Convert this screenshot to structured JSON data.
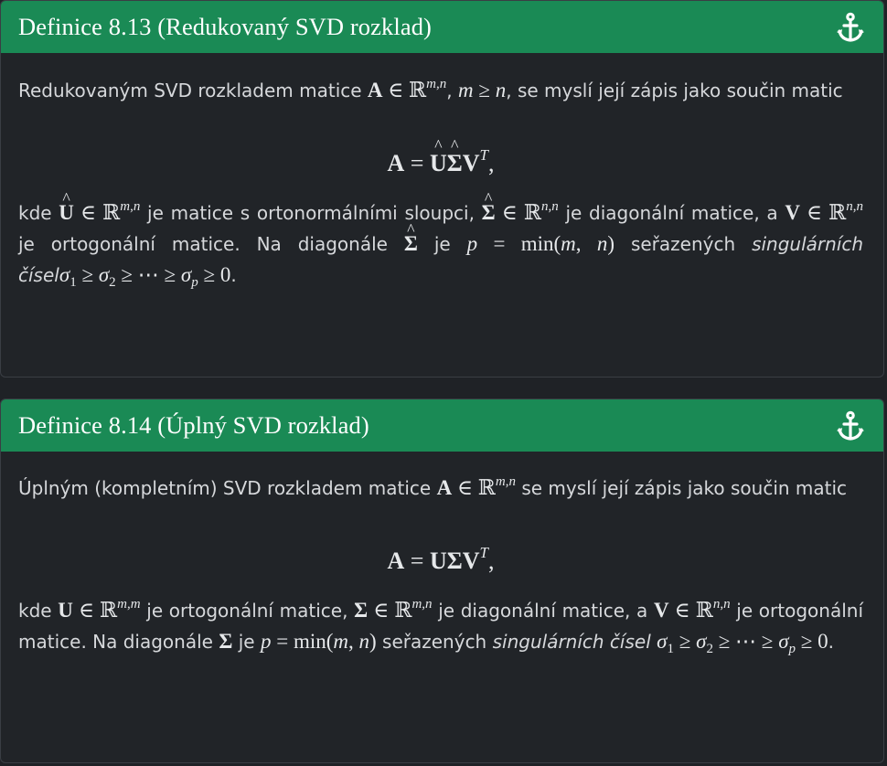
{
  "definitions": [
    {
      "title": "Definice 8.13 (Redukovaný SVD rozklad)",
      "intro_text_1": "Redukovaným SVD rozkladem matice",
      "intro_text_2": ", se myslí její zápis jako součin matic",
      "after_1": "kde",
      "after_2": "je matice s ortonormálními sloupci,",
      "after_3": "je diagonální matice, a",
      "after_4": "je ortogonální matice. Na diagonále",
      "after_5": "je",
      "after_6": "seřazených",
      "singular_phrase": "singulárních čísel",
      "end_dot": "."
    },
    {
      "title": "Definice 8.14 (Úplný SVD rozklad)",
      "intro_text_1": "Úplným (kompletním) SVD rozkladem matice",
      "intro_text_2": "se myslí její zápis jako součin matic",
      "after_1": "kde",
      "after_2": "je ortogonální matice,",
      "after_3": "je diagonální matice, a",
      "after_4": "je ortogonální matice. Na diagonále",
      "after_5": "je",
      "after_6": "seřazených",
      "singular_phrase": "singulárních čísel",
      "end_dot": "."
    }
  ],
  "colors": {
    "header": "#1a8a55",
    "background": "#212428",
    "text": "#d6d8db"
  },
  "icons": {
    "anchor": "anchor-icon"
  }
}
